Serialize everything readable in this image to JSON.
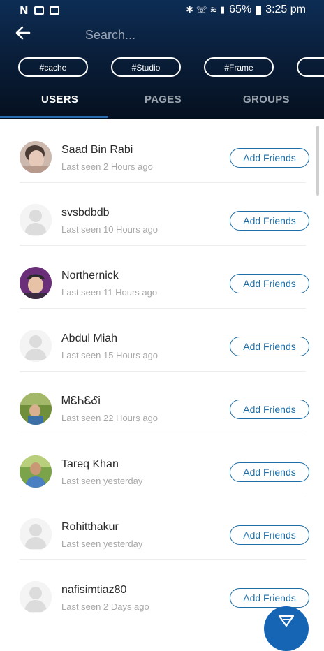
{
  "status_bar": {
    "left_icon_letter": "N",
    "battery": "65%",
    "time": "3:25 pm",
    "right_glyphs": "✱ ☏ ≋ ▮"
  },
  "search": {
    "placeholder": "Search...",
    "value": ""
  },
  "chips": [
    "#cache",
    "#Studio",
    "#Frame"
  ],
  "tabs": [
    {
      "label": "USERS",
      "active": true
    },
    {
      "label": "PAGES",
      "active": false
    },
    {
      "label": "GROUPS",
      "active": false
    }
  ],
  "users": [
    {
      "name": "Saad Bin Rabi",
      "last_seen": "Last seen 2 Hours ago",
      "button": "Add Friends",
      "avatar": "photo-woman"
    },
    {
      "name": "svsbdbdb",
      "last_seen": "Last seen 10 Hours ago",
      "button": "Add Friends",
      "avatar": "placeholder"
    },
    {
      "name": "Northernick",
      "last_seen": "Last seen 11 Hours ago",
      "button": "Add Friends",
      "avatar": "photo-man-cap"
    },
    {
      "name": "Abdul Miah",
      "last_seen": "Last seen 15 Hours ago",
      "button": "Add Friends",
      "avatar": "placeholder"
    },
    {
      "name": "ᎷᏋᏂᏋᎴᎥ",
      "last_seen": "Last seen 22 Hours ago",
      "button": "Add Friends",
      "avatar": "photo-outdoor"
    },
    {
      "name": "Tareq Khan",
      "last_seen": "Last seen yesterday",
      "button": "Add Friends",
      "avatar": "photo-man"
    },
    {
      "name": "Rohitthakur",
      "last_seen": "Last seen yesterday",
      "button": "Add Friends",
      "avatar": "placeholder"
    },
    {
      "name": "nafisimtiaz80",
      "last_seen": "Last seen 2 Days ago",
      "button": "Add Friends",
      "avatar": "placeholder"
    }
  ],
  "colors": {
    "header_top": "#0d2d55",
    "header_bottom": "#05101f",
    "accent": "#1f6fa6",
    "fab": "#1665b4"
  },
  "icons": {
    "back": "back-arrow-icon",
    "fab": "filter-icon"
  }
}
